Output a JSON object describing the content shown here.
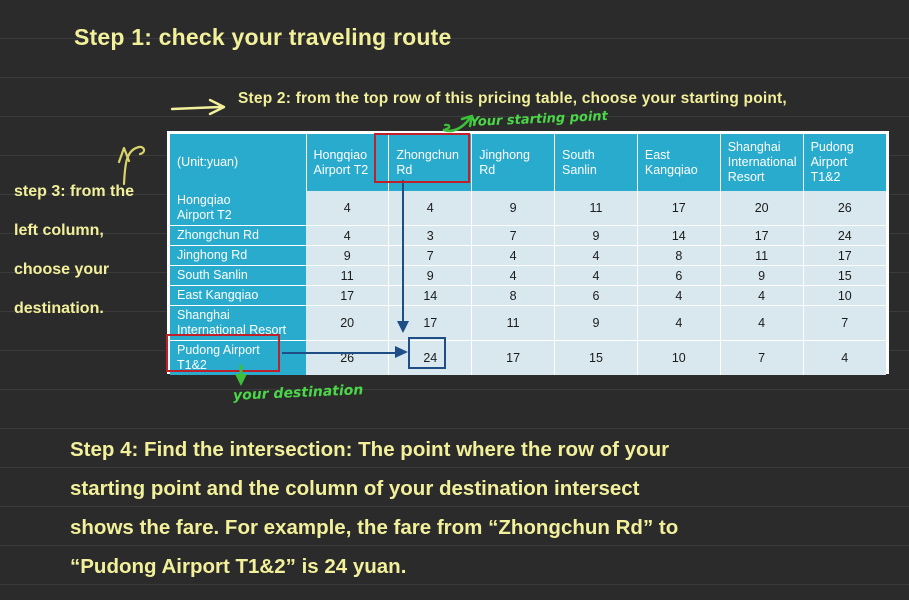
{
  "slide": {
    "background_color": "#2b2b2b",
    "text_color": "#f2f09a",
    "handwriting_color": "#4bd648",
    "table_header_color": "#29abce",
    "table_cell_color": "#d9e8ef",
    "highlight_red": "#c0202a",
    "highlight_blue": "#1f4e87"
  },
  "step1": "Step 1:  check your traveling route",
  "step2": "Step 2:  from the top row of this pricing table,   choose your starting point,",
  "step3": {
    "line1": "step 3: from the",
    "line2": "left column,",
    "line3": "choose your",
    "line4": "destination."
  },
  "step4": {
    "line1": "Step 4: Find the intersection: The point where the row of your",
    "line2": "starting point and the column of your destination intersect",
    "line3": "shows the fare. For example, the fare from “Zhongchun Rd” to",
    "line4": "“Pudong Airport T1&2” is 24 yuan."
  },
  "annotations": {
    "starting_point": "Your starting point",
    "destination": "your destination"
  },
  "chart_data": {
    "type": "table",
    "title": "Pricing table",
    "corner_label": "(Unit:yuan)",
    "columns": [
      "Hongqiao Airport T2",
      "Zhongchun Rd",
      "Jinghong Rd",
      "South Sanlin",
      "East Kangqiao",
      "Shanghai International Resort",
      "Pudong Airport T1&2"
    ],
    "column_lines": [
      [
        "Hongqiao",
        "Airport T2"
      ],
      [
        "Zhongchun",
        "Rd"
      ],
      [
        "Jinghong",
        "Rd"
      ],
      [
        "South",
        "Sanlin"
      ],
      [
        "East",
        "Kangqiao"
      ],
      [
        "Shanghai",
        "International",
        "Resort"
      ],
      [
        "Pudong",
        "Airport T1&2"
      ]
    ],
    "rows": [
      {
        "label_lines": [
          "Hongqiao",
          "Airport T2"
        ],
        "label": "Hongqiao Airport T2",
        "tall": true,
        "values": [
          4,
          4,
          9,
          11,
          17,
          20,
          26
        ]
      },
      {
        "label_lines": [
          "Zhongchun Rd"
        ],
        "label": "Zhongchun Rd",
        "tall": false,
        "values": [
          4,
          3,
          7,
          9,
          14,
          17,
          24
        ]
      },
      {
        "label_lines": [
          "Jinghong Rd"
        ],
        "label": "Jinghong Rd",
        "tall": false,
        "values": [
          9,
          7,
          4,
          4,
          8,
          11,
          17
        ]
      },
      {
        "label_lines": [
          "South Sanlin"
        ],
        "label": "South Sanlin",
        "tall": false,
        "values": [
          11,
          9,
          4,
          4,
          6,
          9,
          15
        ]
      },
      {
        "label_lines": [
          "East Kangqiao"
        ],
        "label": "East Kangqiao",
        "tall": false,
        "values": [
          17,
          14,
          8,
          6,
          4,
          4,
          10
        ]
      },
      {
        "label_lines": [
          "Shanghai",
          "International Resort"
        ],
        "label": "Shanghai International Resort",
        "tall": true,
        "values": [
          20,
          17,
          11,
          9,
          4,
          4,
          7
        ]
      },
      {
        "label_lines": [
          "Pudong Airport",
          "T1&2"
        ],
        "label": "Pudong Airport T1&2",
        "tall": true,
        "values": [
          26,
          24,
          17,
          15,
          10,
          7,
          4
        ]
      }
    ],
    "highlighted_column": "Zhongchun Rd",
    "highlighted_row": "Pudong Airport T1&2",
    "highlighted_value": 24,
    "unit": "yuan"
  }
}
